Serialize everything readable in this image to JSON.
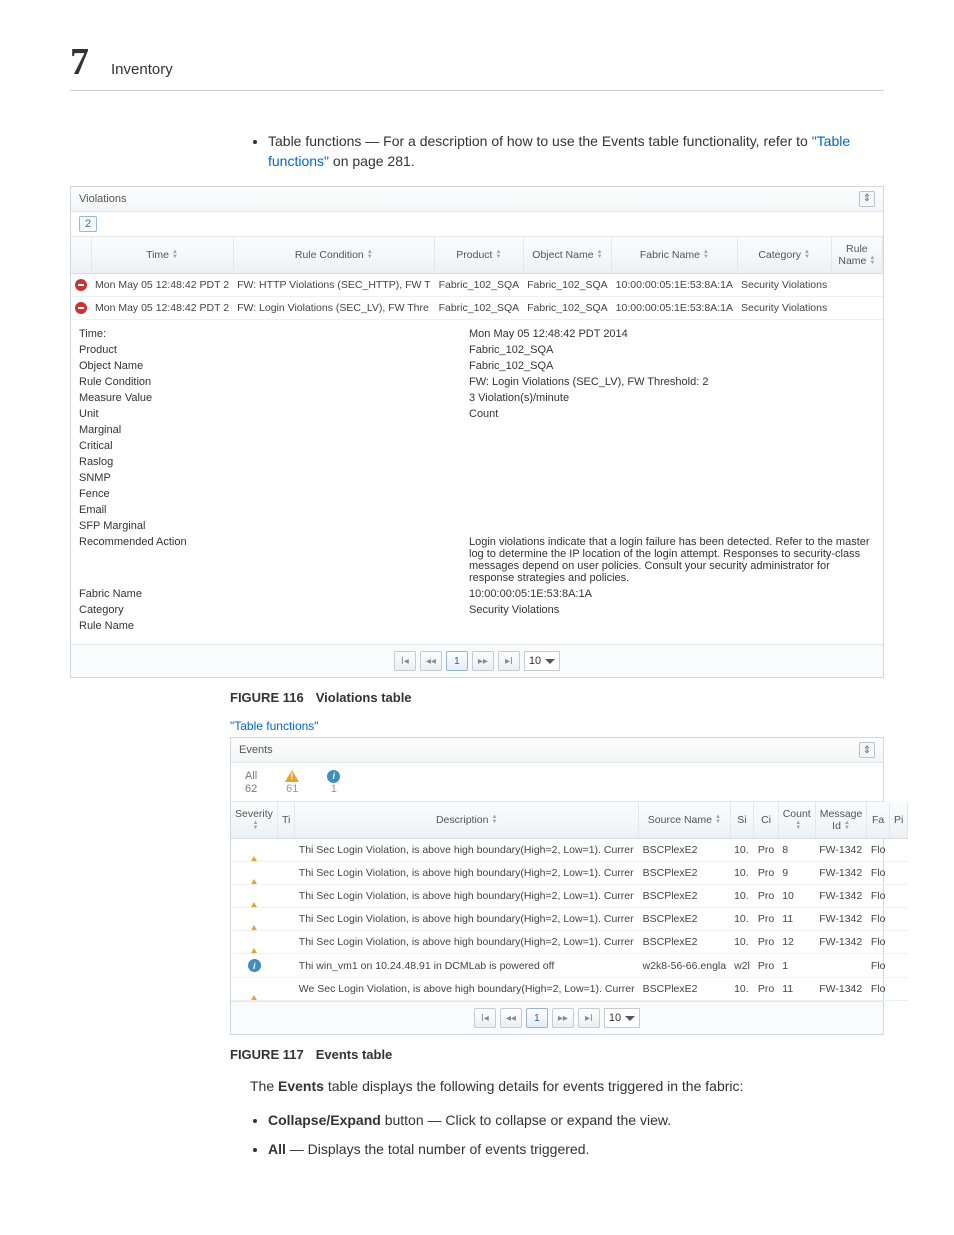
{
  "page_header": {
    "number": "7",
    "section": "Inventory"
  },
  "intro_bullet_pre": "Table functions — For a description of how to use the Events table functionality, refer to ",
  "intro_link": "\"Table functions\"",
  "intro_suffix": " on page 281.",
  "violations": {
    "title": "Violations",
    "filter_badge": "2",
    "columns": [
      "Time",
      "Rule Condition",
      "Product",
      "Object Name",
      "Fabric Name",
      "Category",
      "Rule Name"
    ],
    "rows": [
      {
        "time": "Mon May 05 12:48:42 PDT 2",
        "cond": "FW: HTTP Violations (SEC_HTTP), FW T",
        "prod": "Fabric_102_SQA",
        "obj": "Fabric_102_SQA",
        "fab": "10:00:00:05:1E:53:8A:1A",
        "cat": "Security Violations",
        "rule": ""
      },
      {
        "time": "Mon May 05 12:48:42 PDT 2",
        "cond": "FW: Login Violations (SEC_LV), FW Thre",
        "prod": "Fabric_102_SQA",
        "obj": "Fabric_102_SQA",
        "fab": "10:00:00:05:1E:53:8A:1A",
        "cat": "Security Violations",
        "rule": ""
      }
    ],
    "detail": {
      "Time:": "Mon May 05 12:48:42 PDT 2014",
      "Product": "Fabric_102_SQA",
      "Object Name": "Fabric_102_SQA",
      "Rule Condition": "FW: Login Violations (SEC_LV), FW Threshold: 2",
      "Measure Value": "3 Violation(s)/minute",
      "Unit": "Count",
      "Marginal": "",
      "Critical": "",
      "Raslog": "",
      "SNMP": "",
      "Fence": "",
      "Email": "",
      "SFP Marginal": "",
      "Recommended Action": "Login violations indicate that a login failure has been detected. Refer to the master log to determine the IP location of the login attempt. Responses to security-class messages depend on user policies. Consult your security administrator for response strategies and policies.",
      "Fabric Name": "10:00:00:05:1E:53:8A:1A",
      "Category": "Security Violations",
      "Rule Name": ""
    },
    "pager": {
      "page": "1",
      "size": "10"
    }
  },
  "figure116": {
    "label": "FIGURE 116",
    "caption": "Violations table"
  },
  "table_functions_link": "\"Table functions\"",
  "events": {
    "title": "Events",
    "tabs": [
      {
        "label": "All",
        "count": "62"
      },
      {
        "label": "",
        "count": "61"
      },
      {
        "label": "",
        "count": "1"
      }
    ],
    "columns": [
      "Severity",
      "Ti",
      "Description",
      "Source Name",
      "Si",
      "Ci",
      "Count",
      "Message Id",
      "Fa",
      "Pi"
    ],
    "rows": [
      {
        "sev": "warn",
        "desc": "Thi Sec Login Violation, is above high boundary(High=2, Low=1). Currer",
        "src": "BSCPlexE2",
        "count": "10.",
        "c2": "Pro",
        "c3": "8",
        "msg": "FW-1342",
        "fa": "Flo"
      },
      {
        "sev": "warn",
        "desc": "Thi Sec Login Violation, is above high boundary(High=2, Low=1). Currer",
        "src": "BSCPlexE2",
        "count": "10.",
        "c2": "Pro",
        "c3": "9",
        "msg": "FW-1342",
        "fa": "Flo"
      },
      {
        "sev": "warn",
        "desc": "Thi Sec Login Violation, is above high boundary(High=2, Low=1). Currer",
        "src": "BSCPlexE2",
        "count": "10.",
        "c2": "Pro",
        "c3": "10",
        "msg": "FW-1342",
        "fa": "Flo"
      },
      {
        "sev": "warn",
        "desc": "Thi Sec Login Violation, is above high boundary(High=2, Low=1). Currer",
        "src": "BSCPlexE2",
        "count": "10.",
        "c2": "Pro",
        "c3": "11",
        "msg": "FW-1342",
        "fa": "Flo"
      },
      {
        "sev": "warn",
        "desc": "Thi Sec Login Violation, is above high boundary(High=2, Low=1). Currer",
        "src": "BSCPlexE2",
        "count": "10.",
        "c2": "Pro",
        "c3": "12",
        "msg": "FW-1342",
        "fa": "Flo"
      },
      {
        "sev": "info",
        "desc": "Thi win_vm1 on 10.24.48.91 in DCMLab is powered off",
        "src": "w2k8-56-66.engla",
        "count": "w2l",
        "c2": "Pro",
        "c3": "1",
        "msg": "",
        "fa": "Flo"
      },
      {
        "sev": "warn",
        "desc": "We Sec Login Violation, is above high boundary(High=2, Low=1). Currer",
        "src": "BSCPlexE2",
        "count": "10.",
        "c2": "Pro",
        "c3": "11",
        "msg": "FW-1342",
        "fa": "Flo"
      }
    ],
    "pager": {
      "page": "1",
      "size": "10"
    }
  },
  "figure117": {
    "label": "FIGURE 117",
    "caption": "Events table"
  },
  "events_intro_pre": "The ",
  "events_intro_bold": "Events",
  "events_intro_post": " table displays the following details for events triggered in the fabric:",
  "bullet_collapse_b": "Collapse/Expand",
  "bullet_collapse_t": " button — Click to collapse or expand the view.",
  "bullet_all_b": "All",
  "bullet_all_t": " — Displays the total number of events triggered."
}
